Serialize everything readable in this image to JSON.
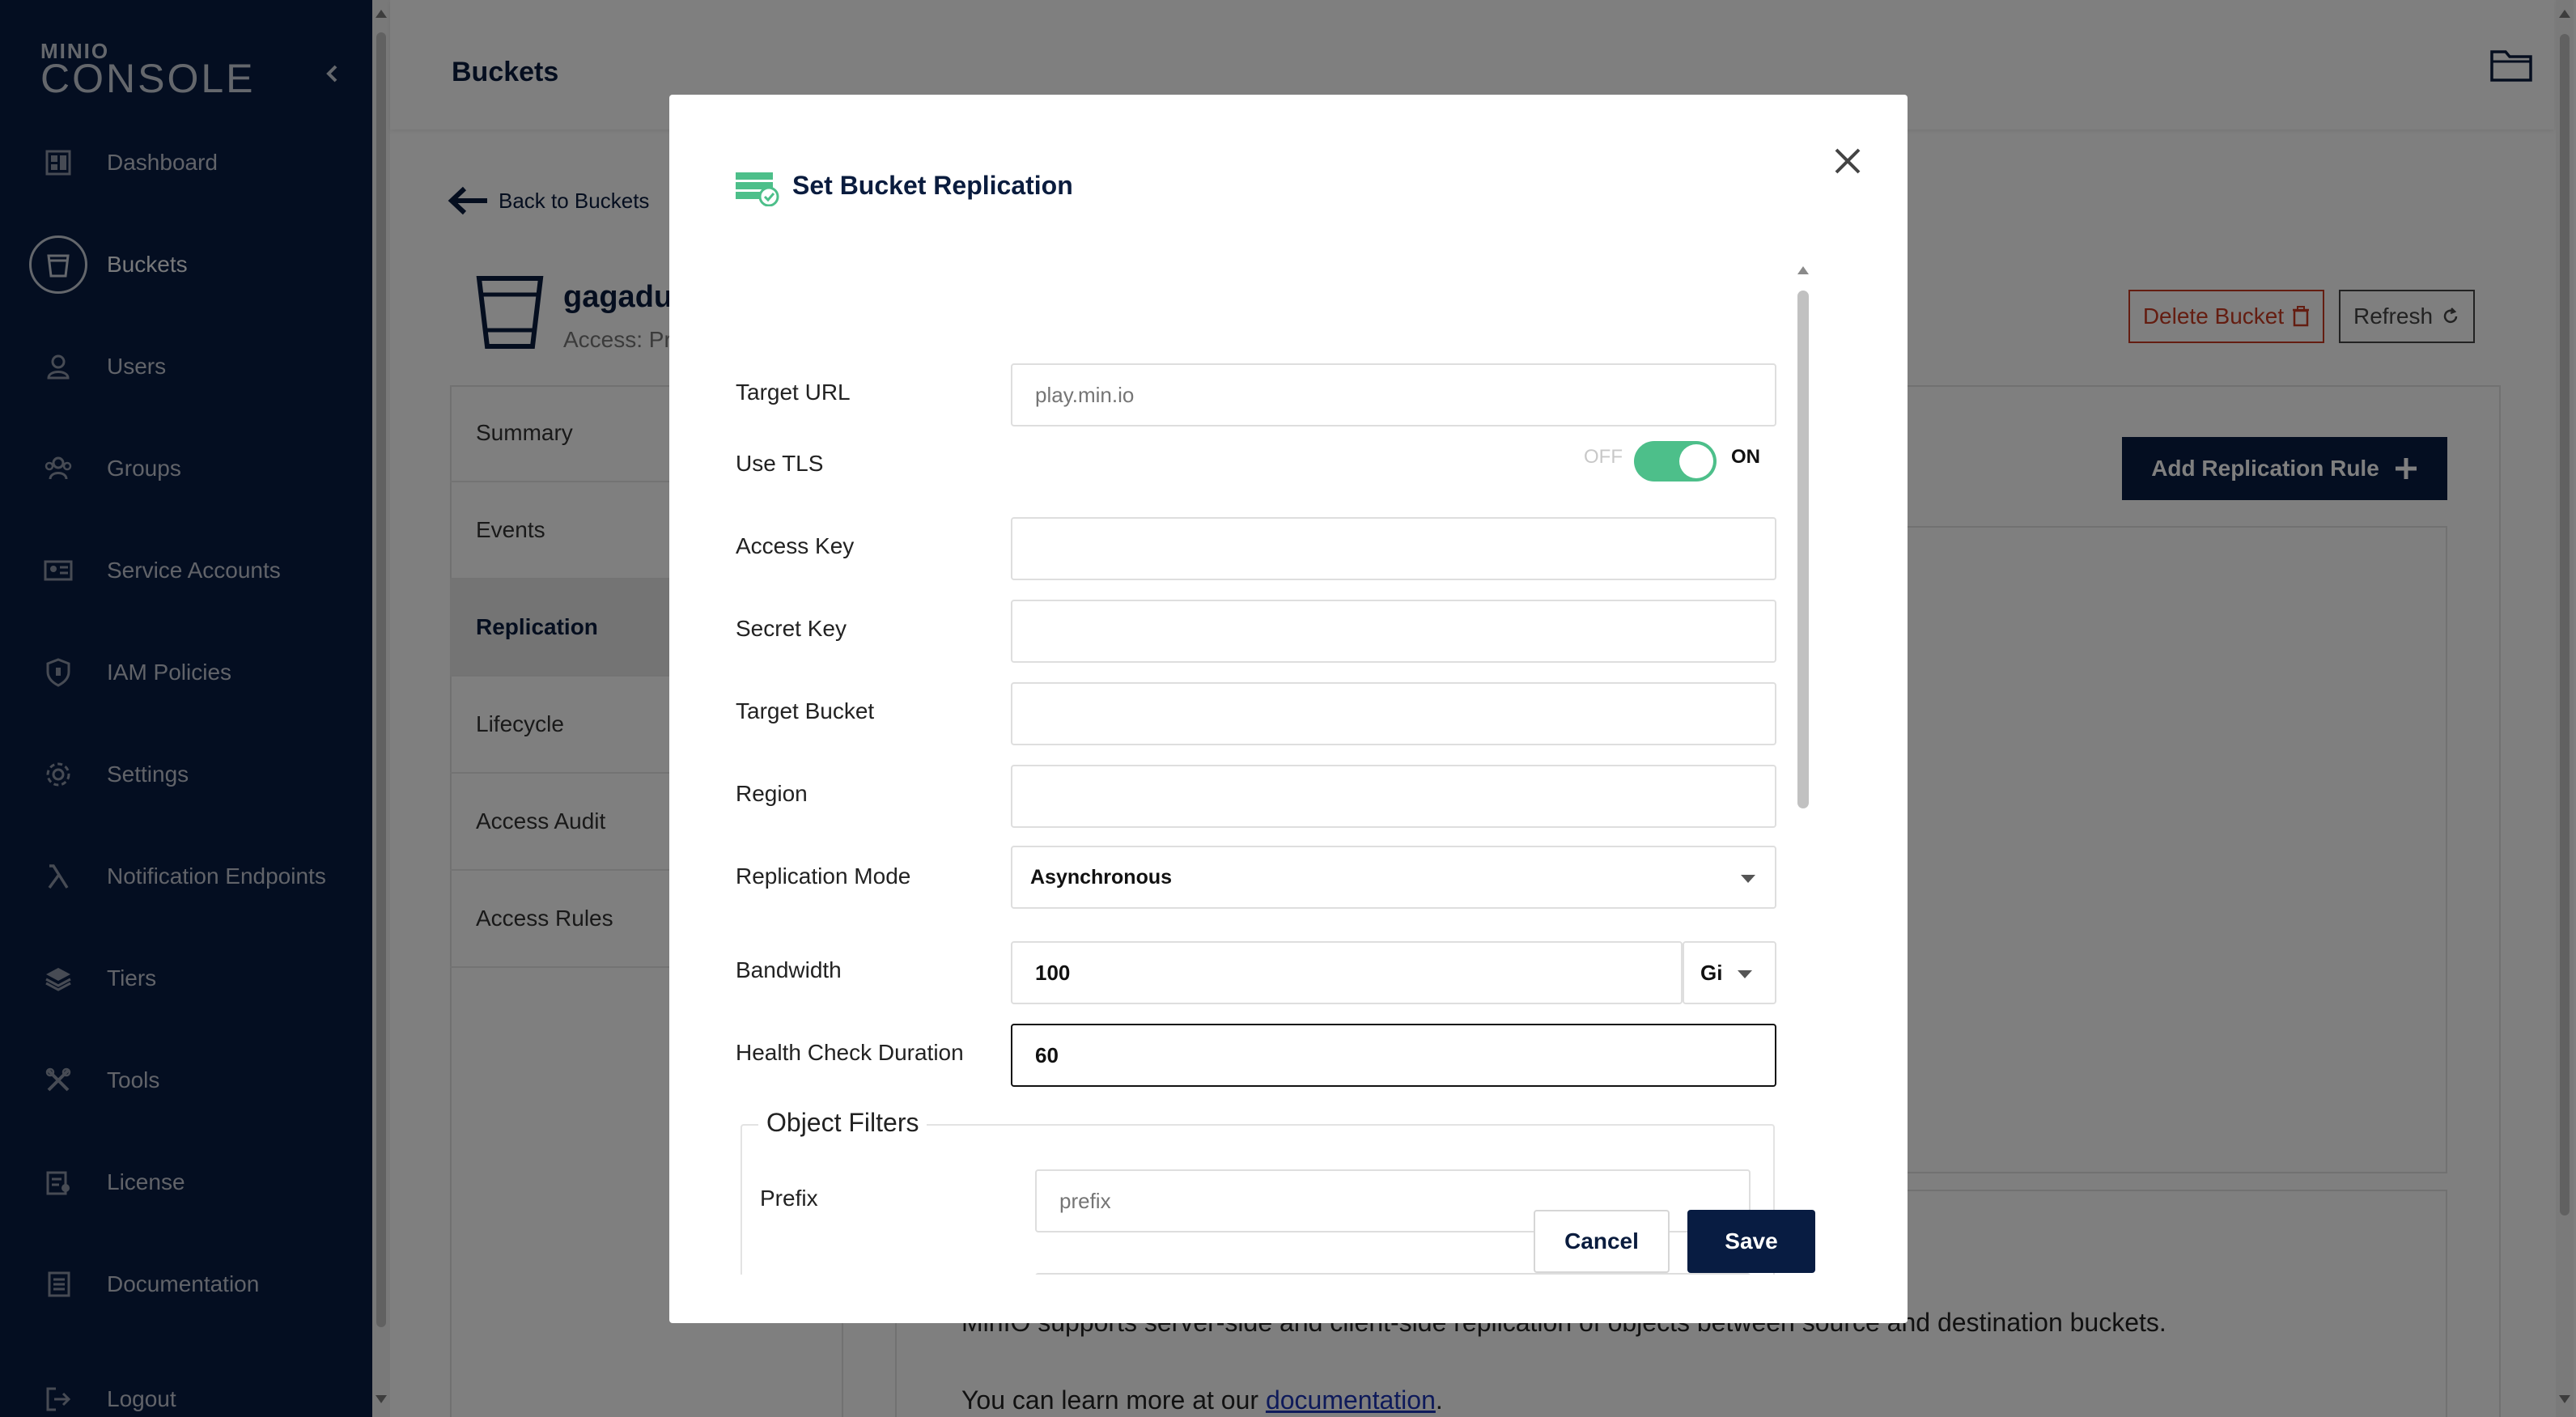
{
  "sidebar": {
    "logo_top": "MINIO",
    "logo_bottom": "CONSOLE",
    "items": [
      {
        "label": "Dashboard",
        "icon": "dashboard-icon"
      },
      {
        "label": "Buckets",
        "icon": "bucket-icon",
        "active": true
      },
      {
        "label": "Users",
        "icon": "user-icon"
      },
      {
        "label": "Groups",
        "icon": "groups-icon"
      },
      {
        "label": "Service Accounts",
        "icon": "service-accounts-icon"
      },
      {
        "label": "IAM Policies",
        "icon": "shield-icon"
      },
      {
        "label": "Settings",
        "icon": "gear-icon"
      },
      {
        "label": "Notification Endpoints",
        "icon": "lambda-icon"
      },
      {
        "label": "Tiers",
        "icon": "layers-icon"
      },
      {
        "label": "Tools",
        "icon": "tools-icon"
      },
      {
        "label": "License",
        "icon": "license-icon"
      },
      {
        "label": "Documentation",
        "icon": "documentation-icon"
      },
      {
        "label": "Logout",
        "icon": "logout-icon"
      }
    ]
  },
  "header": {
    "title": "Buckets"
  },
  "bucket": {
    "back_label": "Back to Buckets",
    "name": "gagadu",
    "access": "Access: Pr",
    "delete_label": "Delete Bucket",
    "refresh_label": "Refresh"
  },
  "tabs": [
    "Summary",
    "Events",
    "Replication",
    "Lifecycle",
    "Access Audit",
    "Access Rules"
  ],
  "active_tab": "Replication",
  "replication": {
    "add_rule_label": "Add Replication Rule",
    "info_text": "MinIO supports server-side and client-side replication of objects between source and destination buckets.",
    "learn_more_prefix": "You can learn more at our ",
    "learn_more_link": "documentation",
    "learn_more_suffix": "."
  },
  "modal": {
    "title": "Set Bucket Replication",
    "target_url": {
      "label": "Target URL",
      "placeholder": "play.min.io",
      "value": ""
    },
    "use_tls": {
      "label": "Use TLS",
      "off": "OFF",
      "on": "ON",
      "enabled": true
    },
    "access_key": {
      "label": "Access Key",
      "value": ""
    },
    "secret_key": {
      "label": "Secret Key",
      "value": ""
    },
    "target_bucket": {
      "label": "Target Bucket",
      "value": ""
    },
    "region": {
      "label": "Region",
      "value": ""
    },
    "replication_mode": {
      "label": "Replication Mode",
      "value": "Asynchronous"
    },
    "bandwidth": {
      "label": "Bandwidth",
      "value": "100",
      "unit": "Gi"
    },
    "health_check": {
      "label": "Health Check Duration",
      "value": "60"
    },
    "object_filters": {
      "legend": "Object Filters",
      "prefix_label": "Prefix",
      "prefix_placeholder": "prefix"
    },
    "cancel_label": "Cancel",
    "save_label": "Save"
  },
  "colors": {
    "sidebar_bg": "#081c42",
    "primary": "#081c42",
    "toggle_on": "#4dbf8a",
    "danger": "#c83b22",
    "link": "#1d35b5"
  }
}
